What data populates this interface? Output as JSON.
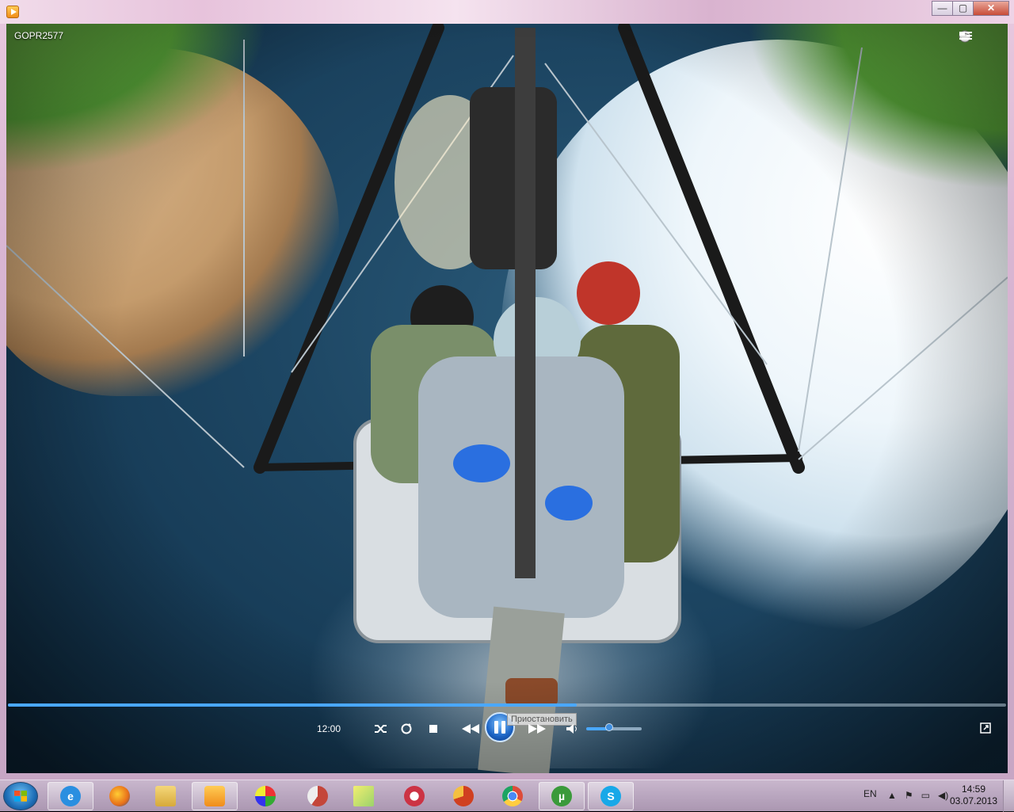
{
  "window": {
    "title": "",
    "buttons": {
      "minimize": "—",
      "maximize": "▢",
      "close": "✕"
    }
  },
  "video": {
    "title": "GOPR2577",
    "icons": [
      "globe-icon",
      "switch-to-library-icon"
    ]
  },
  "controls": {
    "time": "12:00",
    "progress": 0.57,
    "tooltip": "Приостановить",
    "volume": 0.4,
    "buttons": [
      "shuffle-icon",
      "repeat-icon",
      "stop-icon",
      "previous-icon",
      "pause-icon",
      "next-icon",
      "volume-icon",
      "fullscreen-icon"
    ],
    "accent": "#4aa8ff"
  },
  "taskbar": {
    "apps": [
      {
        "name": "internet-explorer",
        "glyph": "e",
        "color": "#2a8fe0"
      },
      {
        "name": "firefox",
        "glyph": "",
        "color": "#e8701a"
      },
      {
        "name": "windows-explorer",
        "glyph": "",
        "color": "#e9c35a"
      },
      {
        "name": "windows-media-player",
        "glyph": "",
        "color": "#f08c1a"
      },
      {
        "name": "paint",
        "glyph": "",
        "color": "#7aa6d8"
      },
      {
        "name": "app-red-swirl",
        "glyph": "",
        "color": "#c4463a"
      },
      {
        "name": "sticky-notes",
        "glyph": "",
        "color": "#d7d04a"
      },
      {
        "name": "snipping-tool",
        "glyph": "",
        "color": "#cc3344"
      },
      {
        "name": "ccleaner",
        "glyph": "",
        "color": "#d04020"
      },
      {
        "name": "chrome",
        "glyph": "",
        "color": "#dd4b39"
      },
      {
        "name": "utorrent",
        "glyph": "µ",
        "color": "#3a9a3a"
      },
      {
        "name": "skype",
        "glyph": "S",
        "color": "#18a8e8"
      }
    ],
    "language": "EN",
    "clock_time": "14:59",
    "clock_date": "03.07.2013"
  }
}
